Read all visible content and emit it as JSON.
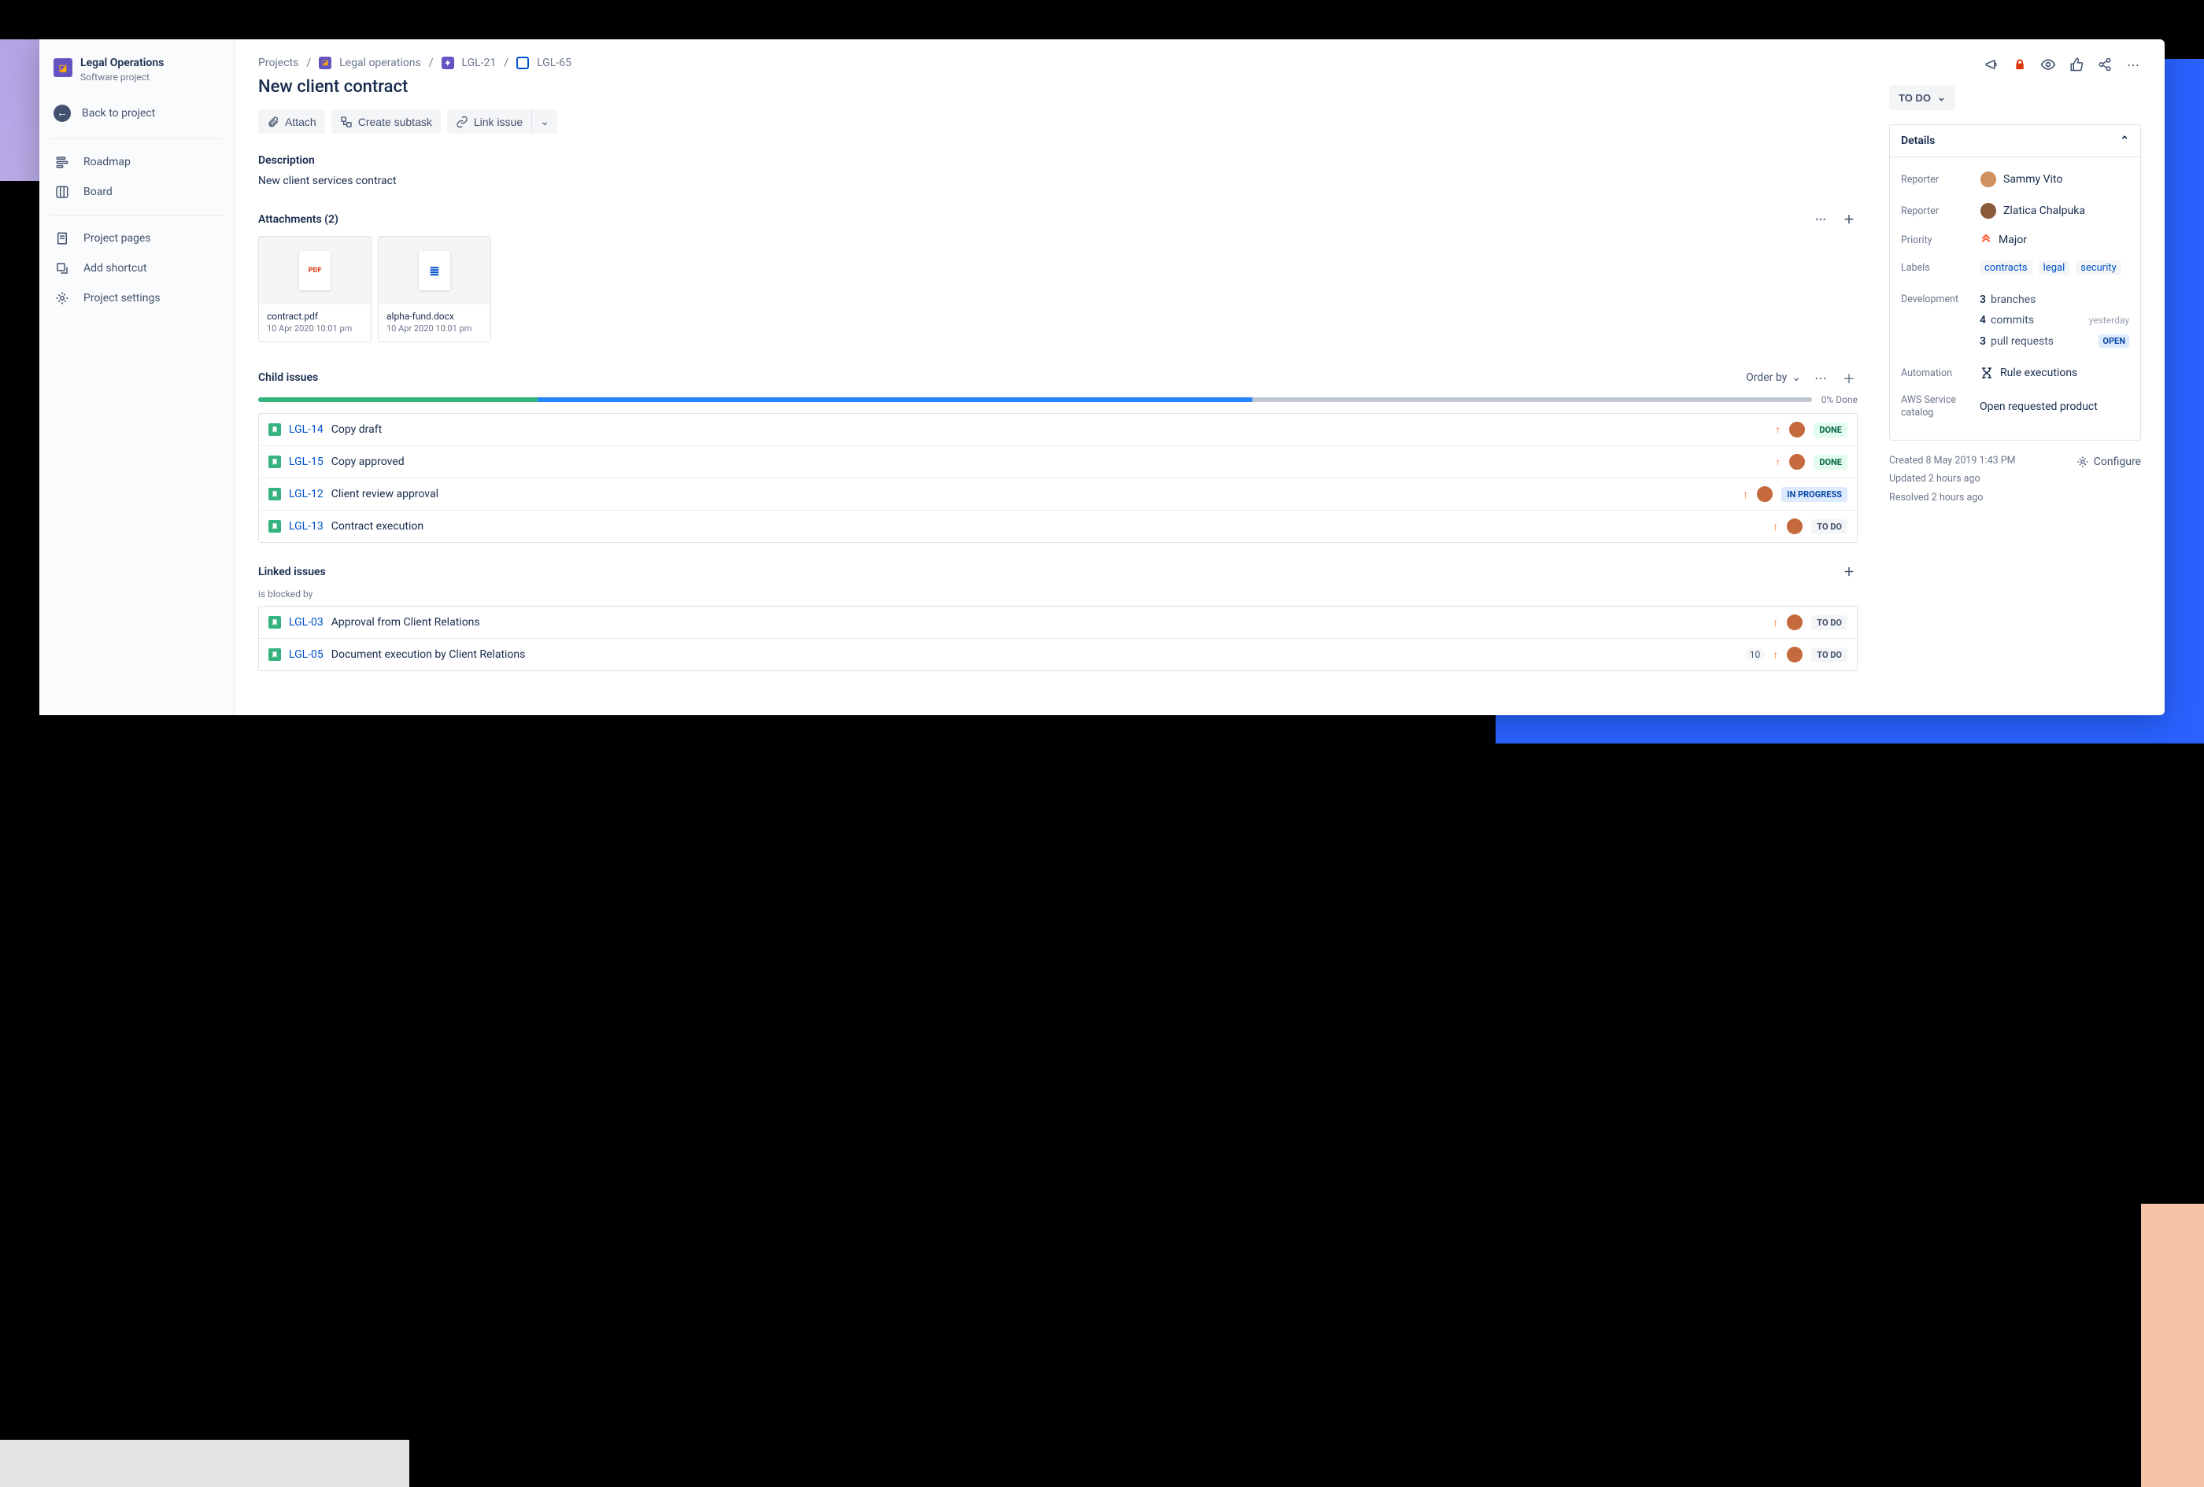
{
  "sidebar": {
    "project_title": "Legal Operations",
    "project_subtitle": "Software project",
    "back_label": "Back to project",
    "nav": [
      {
        "label": "Roadmap"
      },
      {
        "label": "Board"
      }
    ],
    "nav2": [
      {
        "label": "Project pages"
      },
      {
        "label": "Add shortcut"
      },
      {
        "label": "Project settings"
      }
    ]
  },
  "breadcrumbs": {
    "root": "Projects",
    "project": "Legal operations",
    "parent_key": "LGL-21",
    "issue_key": "LGL-65"
  },
  "issue": {
    "title": "New client contract",
    "toolbar": {
      "attach": "Attach",
      "subtask": "Create subtask",
      "link": "Link issue"
    },
    "description_head": "Description",
    "description_text": "New client services contract"
  },
  "attachments": {
    "head": "Attachments (2)",
    "items": [
      {
        "badge": "PDF",
        "name": "contract.pdf",
        "date": "10 Apr 2020 10:01 pm",
        "kind": "pdf"
      },
      {
        "badge": "≣",
        "name": "alpha-fund.docx",
        "date": "10 Apr 2020 10:01 pm",
        "kind": "doc"
      }
    ]
  },
  "child_issues": {
    "head": "Child issues",
    "order_label": "Order by",
    "progress_label": "0% Done",
    "progress": {
      "done_pct": 18,
      "progress_pct": 46
    },
    "items": [
      {
        "key": "LGL-14",
        "summary": "Copy draft",
        "status": "DONE",
        "status_class": "st-done"
      },
      {
        "key": "LGL-15",
        "summary": "Copy approved",
        "status": "DONE",
        "status_class": "st-done"
      },
      {
        "key": "LGL-12",
        "summary": "Client review approval",
        "status": "IN PROGRESS",
        "status_class": "st-progress"
      },
      {
        "key": "LGL-13",
        "summary": "Contract execution",
        "status": "TO DO",
        "status_class": "st-todo"
      }
    ]
  },
  "linked": {
    "head": "Linked issues",
    "relation": "is blocked by",
    "items": [
      {
        "key": "LGL-03",
        "summary": "Approval from Client Relations",
        "status": "TO DO",
        "count": ""
      },
      {
        "key": "LGL-05",
        "summary": "Document execution by Client Relations",
        "status": "TO DO",
        "count": "10"
      }
    ]
  },
  "right": {
    "status": "TO DO",
    "details_head": "Details",
    "reporter1_label": "Reporter",
    "reporter1_name": "Sammy Vito",
    "reporter2_label": "Reporter",
    "reporter2_name": "Zlatica Chalpuka",
    "priority_label": "Priority",
    "priority_value": "Major",
    "labels_label": "Labels",
    "labels": [
      "contracts",
      "legal",
      "security"
    ],
    "dev_label": "Development",
    "dev": {
      "branches_n": "3",
      "branches_t": "branches",
      "commits_n": "4",
      "commits_t": "commits",
      "commits_meta": "yesterday",
      "prs_n": "3",
      "prs_t": "pull requests",
      "prs_badge": "OPEN"
    },
    "automation_label": "Automation",
    "automation_value": "Rule executions",
    "aws_label": "AWS Service catalog",
    "aws_value": "Open requested product",
    "created": "Created 8 May 2019 1:43 PM",
    "updated": "Updated 2 hours ago",
    "resolved": "Resolved 2 hours ago",
    "configure": "Configure"
  }
}
